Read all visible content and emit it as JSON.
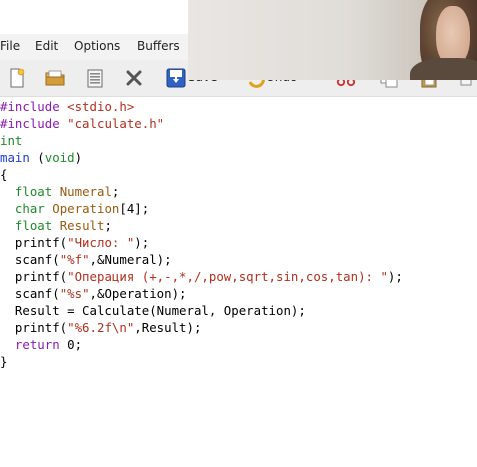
{
  "menubar": {
    "file": "File",
    "edit": "Edit",
    "options": "Options",
    "buffers": "Buffers"
  },
  "toolbar": {
    "save_label": "Save",
    "undo_label": "Undo",
    "icons": [
      "new-file-icon",
      "open-folder-icon",
      "dired-icon",
      "close-icon",
      "save-icon",
      "undo-icon",
      "cut-icon",
      "copy-icon",
      "paste-icon"
    ]
  },
  "code": {
    "l1": [
      "#include ",
      "<stdio.h>"
    ],
    "l2": [
      "#include ",
      "\"calculate.h\""
    ],
    "l3": [
      "int"
    ],
    "l4": [
      "main",
      " (",
      "void",
      ")"
    ],
    "l5": [
      "{"
    ],
    "l6": [
      "  ",
      "float",
      " ",
      "Numeral",
      ";"
    ],
    "l7": [
      "  ",
      "char",
      " ",
      "Operation",
      "[4];"
    ],
    "l8": [
      "  ",
      "float",
      " ",
      "Result",
      ";"
    ],
    "l9": [
      "  printf(",
      "\"Число: \"",
      ");"
    ],
    "l10": [
      "  scanf(",
      "\"%f\"",
      ",&Numeral);"
    ],
    "l11": [
      "  printf(",
      "\"Операция (+,-,*,/,pow,sqrt,sin,cos,tan): \"",
      ");"
    ],
    "l12": [
      "  scanf(",
      "\"%s\"",
      ",&Operation);"
    ],
    "l13": [
      "  Result = Calculate(Numeral, Operation);"
    ],
    "l14": [
      "  printf(",
      "\"%6.2f\\n\"",
      ",Result);"
    ],
    "l15": [
      "  ",
      "return",
      " 0;"
    ],
    "l16": [
      "}"
    ]
  },
  "colors": {
    "preprocessor": "#8c1ab3",
    "string": "#b1301f",
    "type": "#1f8a2a",
    "function": "#1d3bd0",
    "variable": "#9a5a10",
    "keyword": "#8c1ab3"
  }
}
